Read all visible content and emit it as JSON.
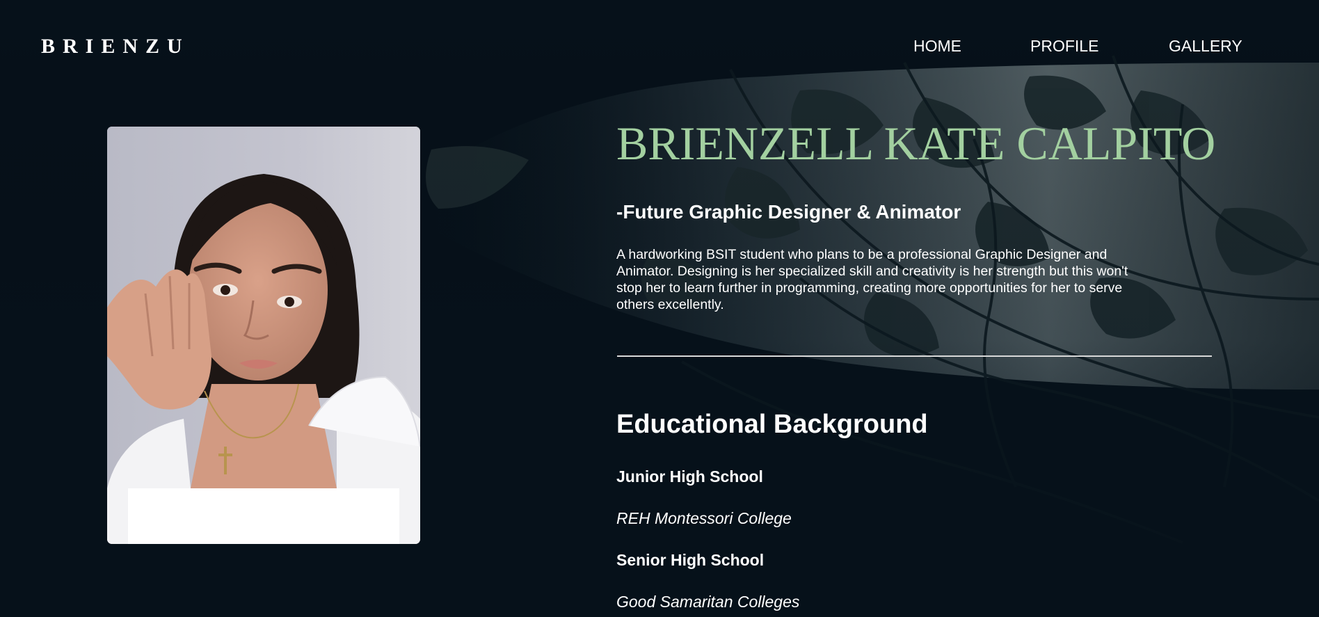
{
  "header": {
    "brand": "BRIENZU",
    "nav": [
      {
        "label": "HOME"
      },
      {
        "label": "PROFILE"
      },
      {
        "label": "GALLERY"
      }
    ]
  },
  "profile": {
    "name": "BRIENZELL KATE CALPITO",
    "tagline": "-Future Graphic Designer & Animator",
    "bio": "A hardworking BSIT student who plans to be a professional Graphic Designer and Animator. Designing is her specialized skill and creativity is her strength but this won't stop her to learn further in programming, creating more opportunities for her to serve others excellently."
  },
  "education": {
    "title": "Educational Background",
    "entries": [
      {
        "level": "Junior High School",
        "school": "REH Montessori College"
      },
      {
        "level": "Senior High School",
        "school": "Good Samaritan Colleges"
      }
    ]
  },
  "colors": {
    "background": "#06111a",
    "name_accent": "#a3d0a0",
    "text": "#ffffff"
  }
}
